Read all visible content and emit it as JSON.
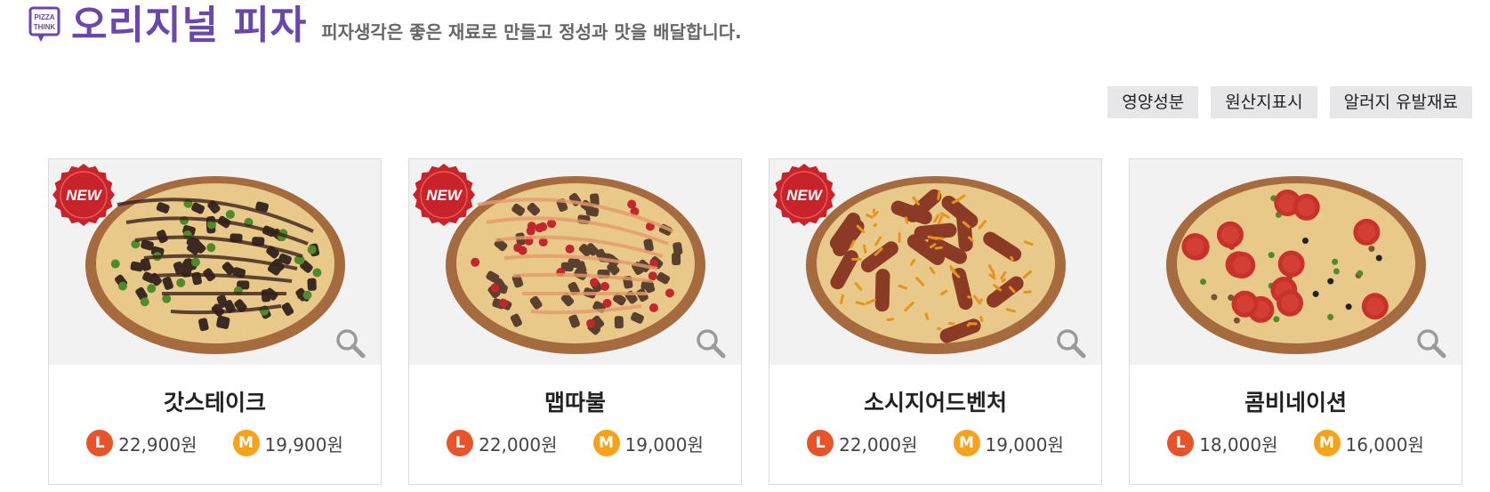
{
  "header": {
    "logo_text": "PIZZA THINK",
    "title": "오리지널 피자",
    "subtitle": "피자생각은 좋은 재료로 만들고 정성과 맛을 배달합니다."
  },
  "info_buttons": [
    "영양성분",
    "원산지표시",
    "알러지 유발재료"
  ],
  "badge_text": "NEW",
  "colors": {
    "brand": "#6a47ad",
    "badge_red": "#c8222a",
    "size_large": "#e8542a",
    "size_medium": "#f6a31b"
  },
  "products": [
    {
      "name": "갓스테이크",
      "is_new": true,
      "large_label": "L",
      "large_price": "22,900원",
      "medium_label": "M",
      "medium_price": "19,900원",
      "topping": "steak"
    },
    {
      "name": "맵따불",
      "is_new": true,
      "large_label": "L",
      "large_price": "22,000원",
      "medium_label": "M",
      "medium_price": "19,000원",
      "topping": "bulgogi"
    },
    {
      "name": "소시지어드벤처",
      "is_new": true,
      "large_label": "L",
      "large_price": "22,000원",
      "medium_label": "M",
      "medium_price": "19,000원",
      "topping": "sausage"
    },
    {
      "name": "콤비네이션",
      "is_new": false,
      "large_label": "L",
      "large_price": "18,000원",
      "medium_label": "M",
      "medium_price": "16,000원",
      "topping": "combination"
    }
  ]
}
